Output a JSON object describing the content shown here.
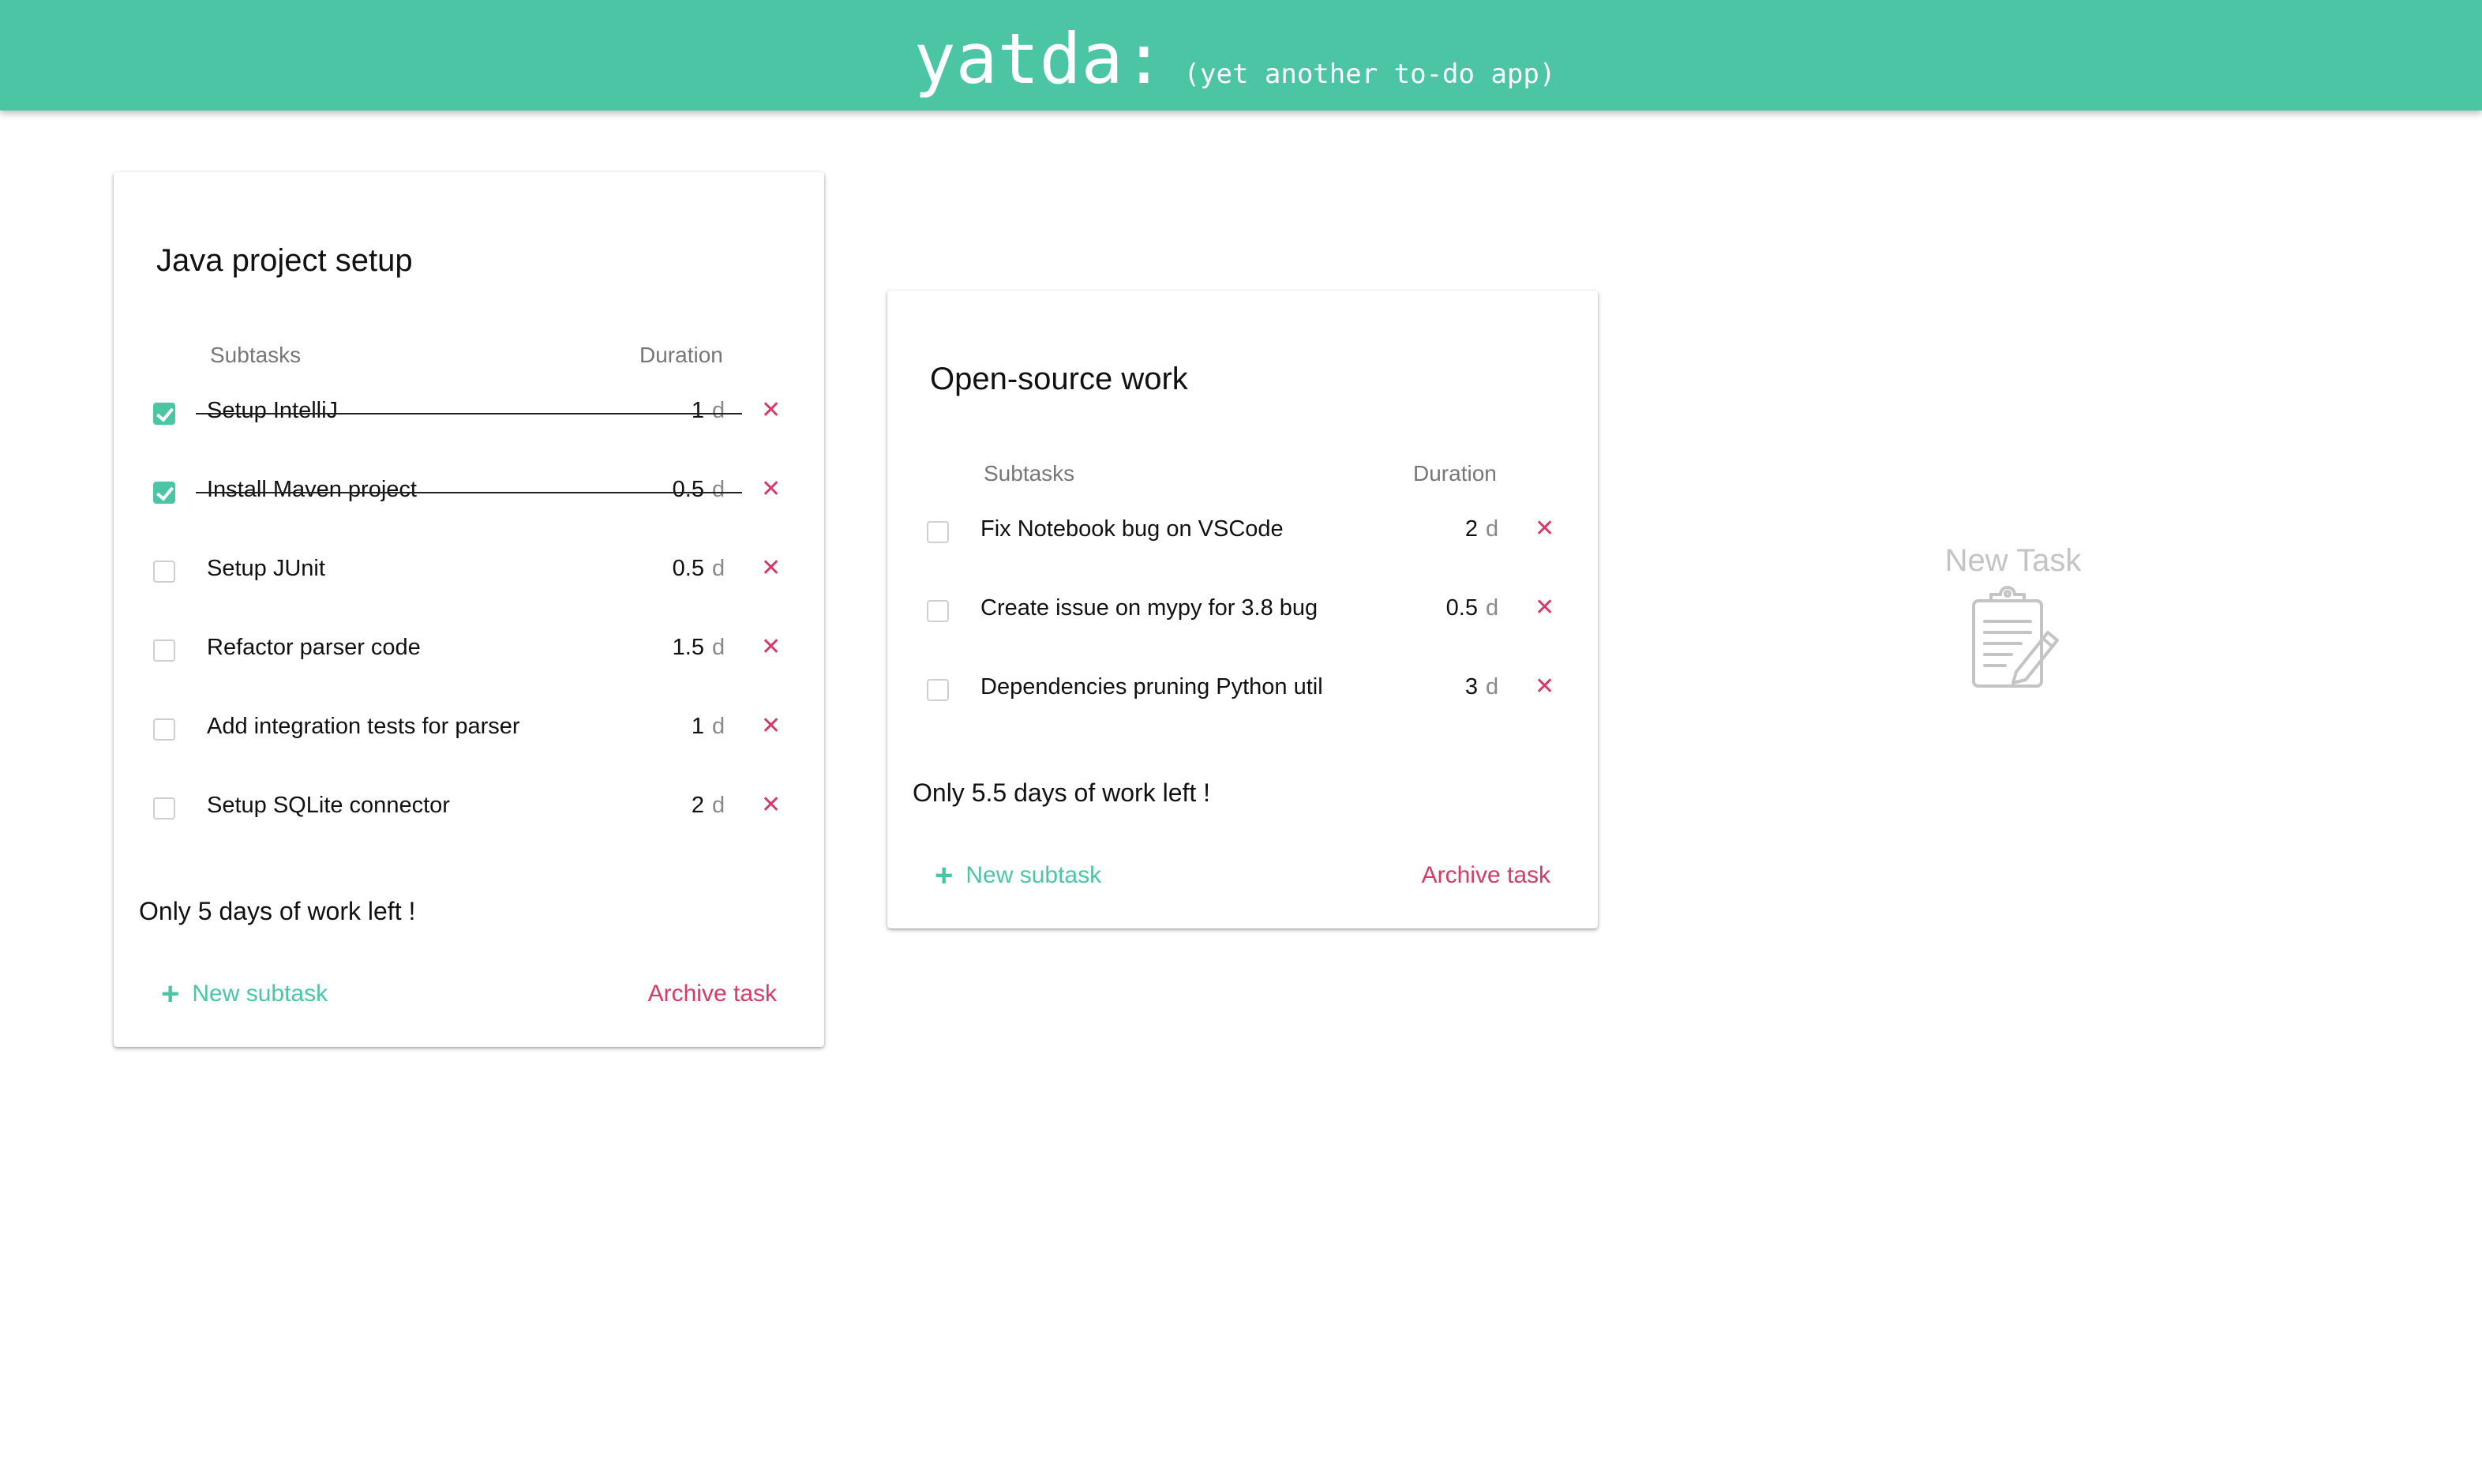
{
  "header": {
    "app_name": "yatda:",
    "tagline": "(yet another to-do app)"
  },
  "columns": {
    "subtasks": "Subtasks",
    "duration": "Duration"
  },
  "tasks": [
    {
      "title": "Java project setup",
      "subtasks": [
        {
          "name": "Setup IntelliJ",
          "duration": "1",
          "unit": "d",
          "done": true
        },
        {
          "name": "Install Maven project",
          "duration": "0.5",
          "unit": "d",
          "done": true
        },
        {
          "name": "Setup JUnit",
          "duration": "0.5",
          "unit": "d",
          "done": false
        },
        {
          "name": "Refactor parser code",
          "duration": "1.5",
          "unit": "d",
          "done": false
        },
        {
          "name": "Add integration tests for parser",
          "duration": "1",
          "unit": "d",
          "done": false
        },
        {
          "name": "Setup SQLite connector",
          "duration": "2",
          "unit": "d",
          "done": false
        }
      ],
      "summary": "Only 5 days of work left !",
      "new_subtask_label": "New subtask",
      "archive_label": "Archive task"
    },
    {
      "title": "Open-source work",
      "subtasks": [
        {
          "name": "Fix Notebook bug on VSCode",
          "duration": "2",
          "unit": "d",
          "done": false
        },
        {
          "name": "Create issue on mypy for 3.8 bug",
          "duration": "0.5",
          "unit": "d",
          "done": false
        },
        {
          "name": "Dependencies pruning Python util",
          "duration": "3",
          "unit": "d",
          "done": false
        }
      ],
      "summary": "Only 5.5 days of work left !",
      "new_subtask_label": "New subtask",
      "archive_label": "Archive task"
    }
  ],
  "new_task": {
    "label": "New Task",
    "icon": "clipboard-edit-icon"
  },
  "colors": {
    "accent": "#4cc5a4",
    "danger": "#d63a66",
    "muted": "#c4c4c4"
  }
}
